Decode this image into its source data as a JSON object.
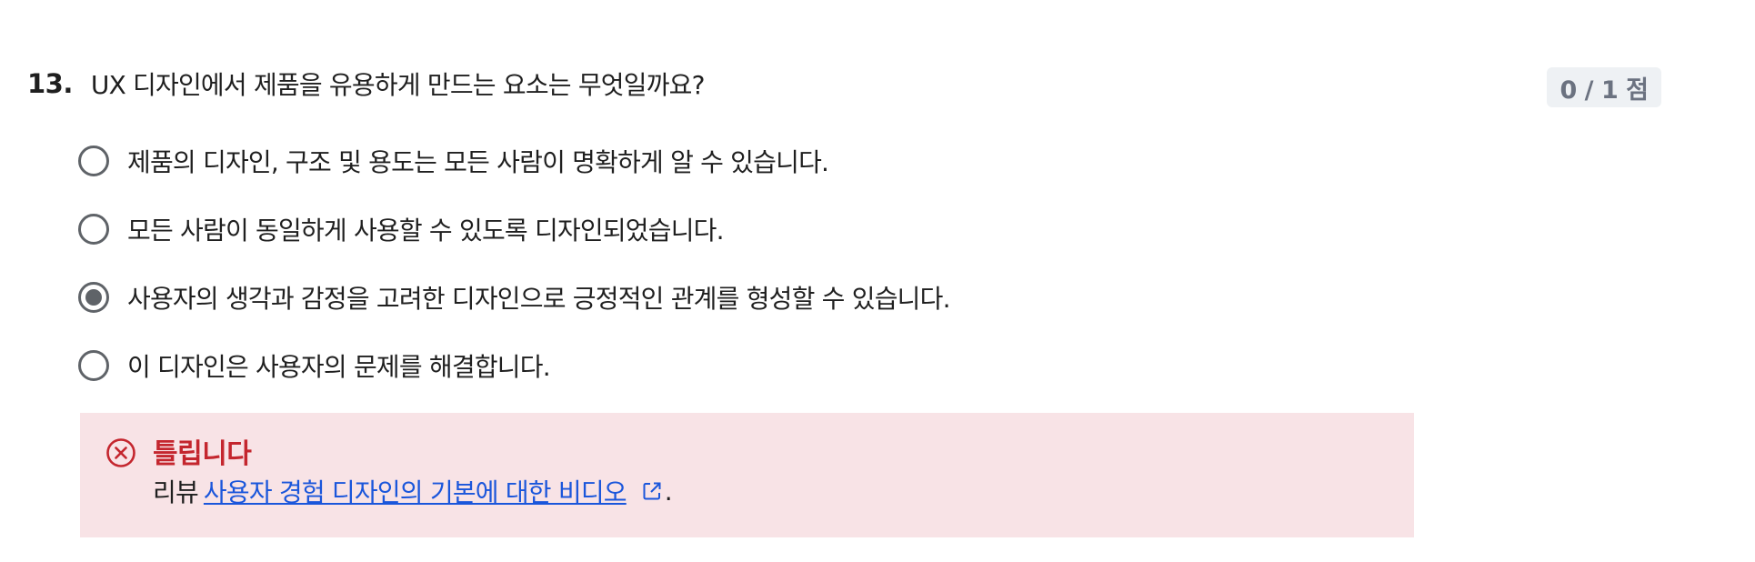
{
  "question": {
    "number": "13.",
    "text": "UX 디자인에서 제품을 유용하게 만드는 요소는 무엇일까요?",
    "score": "0 / 1 점"
  },
  "options": [
    {
      "label": "제품의 디자인, 구조 및 용도는 모든 사람이 명확하게 알 수 있습니다.",
      "selected": false
    },
    {
      "label": "모든 사람이 동일하게 사용할 수 있도록 디자인되었습니다.",
      "selected": false
    },
    {
      "label": "사용자의 생각과 감정을 고려한 디자인으로 긍정적인 관계를 형성할 수 있습니다.",
      "selected": true
    },
    {
      "label": "이 디자인은 사용자의 문제를 해결합니다.",
      "selected": false
    }
  ],
  "feedback": {
    "title": "틀립니다",
    "prefix": "리뷰",
    "link_text": "사용자 경험 디자인의 기본에 대한 비디오",
    "suffix": ".",
    "icon": "error-circle-x-icon",
    "link_icon": "external-link-icon"
  },
  "colors": {
    "error": "#c4262e",
    "error_bg": "#f8e3e6",
    "link": "#1a56db",
    "radio": "#5f6368",
    "badge_bg": "#eef1f4"
  }
}
